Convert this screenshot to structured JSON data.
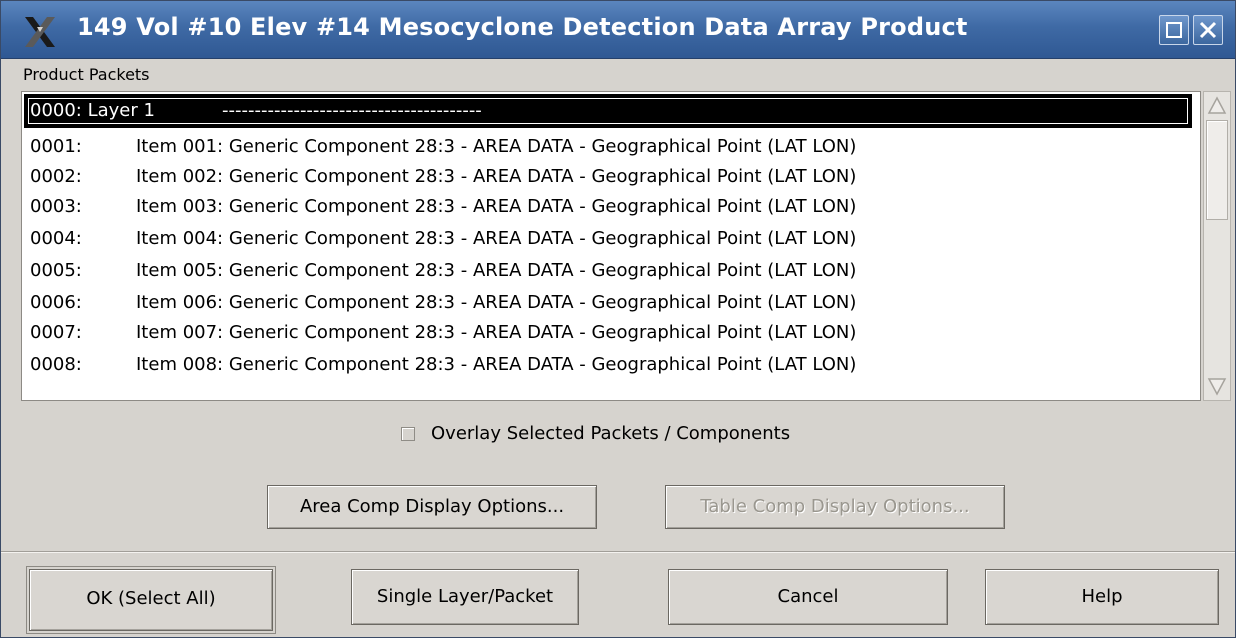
{
  "window": {
    "title": "149  Vol #10  Elev #14  Mesocyclone Detection Data Array Product"
  },
  "product_packets": {
    "label": "Product Packets",
    "items": [
      {
        "index": "0000: Layer   1",
        "desc": "----------------------------------------",
        "selected": true
      },
      {
        "index": "0001:",
        "desc": "Item 001:  Generic Component  28:3  - AREA DATA -  Geographical Point (LAT LON)"
      },
      {
        "index": "0002:",
        "desc": "Item 002:  Generic Component  28:3  - AREA DATA -  Geographical Point (LAT LON)"
      },
      {
        "index": "0003:",
        "desc": "Item 003:  Generic Component  28:3  - AREA DATA -  Geographical Point (LAT LON)"
      },
      {
        "index": "0004:",
        "desc": "Item 004:  Generic Component  28:3  - AREA DATA -  Geographical Point (LAT LON)"
      },
      {
        "index": "0005:",
        "desc": "Item 005:  Generic Component  28:3  - AREA DATA -  Geographical Point (LAT LON)"
      },
      {
        "index": "0006:",
        "desc": "Item 006:  Generic Component  28:3  - AREA DATA -  Geographical Point (LAT LON)"
      },
      {
        "index": "0007:",
        "desc": "Item 007:  Generic Component  28:3  - AREA DATA -  Geographical Point (LAT LON)"
      },
      {
        "index": "0008:",
        "desc": "Item 008:  Generic Component  28:3  - AREA DATA -  Geographical Point (LAT LON)"
      }
    ]
  },
  "overlay": {
    "label": "Overlay Selected Packets / Components",
    "checked": false
  },
  "options": {
    "area_label": "Area Comp Display Options...",
    "table_label": "Table Comp Display Options..."
  },
  "footer": {
    "ok_label": "OK (Select All)",
    "single_label": "Single Layer/Packet",
    "cancel_label": "Cancel",
    "help_label": "Help"
  },
  "colors": {
    "titlebar": "#3f6aa5",
    "window_bg": "#d6d3ce",
    "selection_bg": "#000000"
  }
}
